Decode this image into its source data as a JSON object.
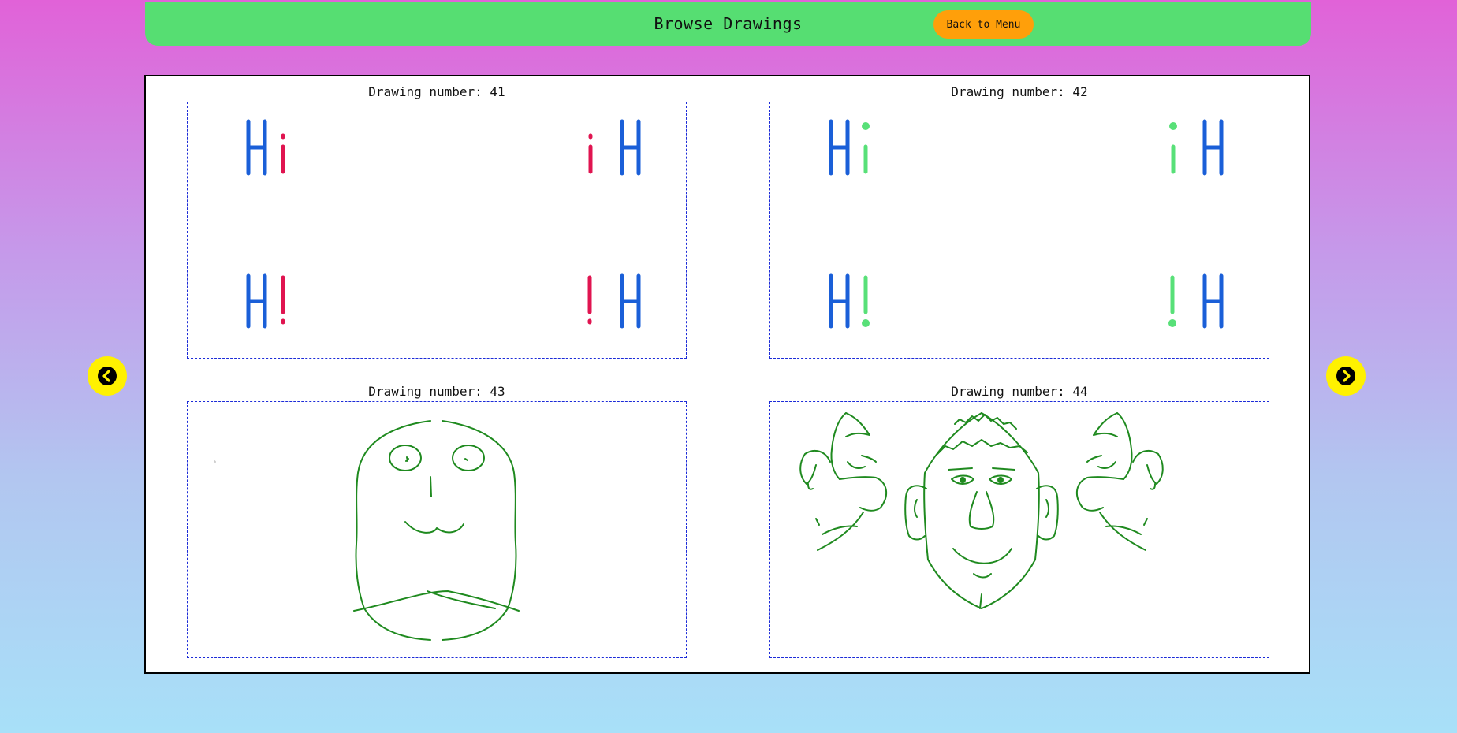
{
  "header": {
    "title": "Browse Drawings",
    "back_label": "Back to Menu"
  },
  "drawings": [
    {
      "label": "Drawing number: 41"
    },
    {
      "label": "Drawing number: 42"
    },
    {
      "label": "Drawing number: 43"
    },
    {
      "label": "Drawing number: 44"
    }
  ],
  "nav": {
    "prev_icon": "chevron-left-circle-icon",
    "next_icon": "chevron-right-circle-icon"
  },
  "colors": {
    "header_bg": "#56de72",
    "back_button_bg": "#ff9f0a",
    "nav_button_bg": "#fff100",
    "canvas_border": "#1c2bd8",
    "ink_blue": "#1a5fd8",
    "ink_red": "#e01450",
    "ink_green_light": "#58e078",
    "ink_green_dark": "#1f8a1f"
  }
}
